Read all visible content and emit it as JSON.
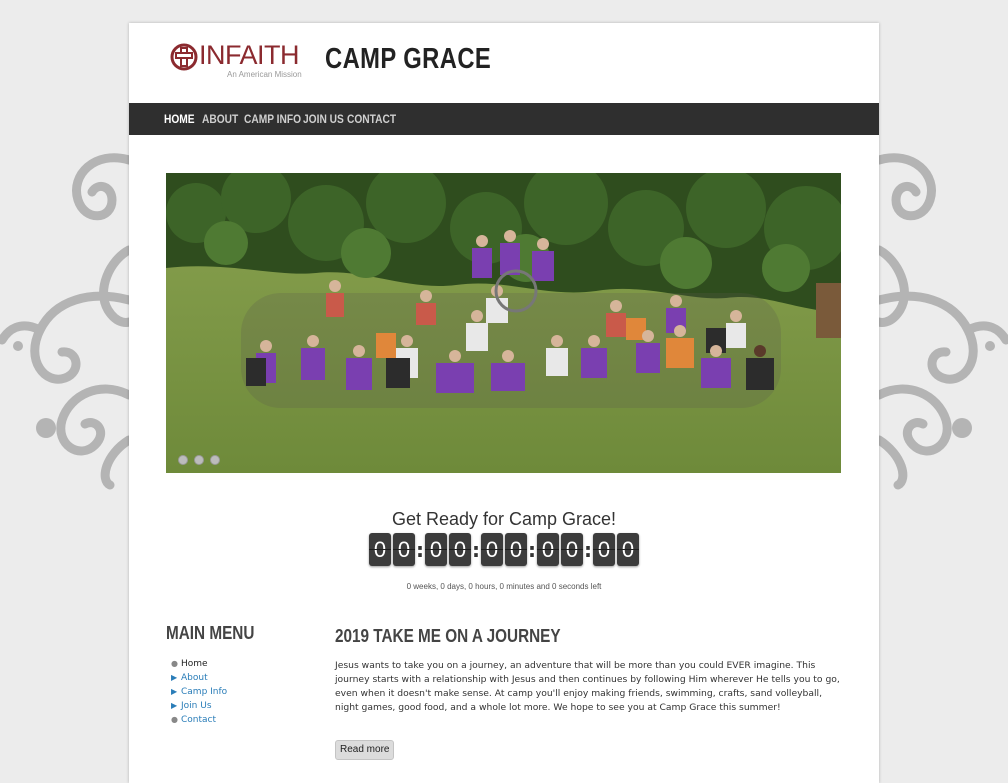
{
  "logo": {
    "wordmark": "INFAITH",
    "tagline": "An American Mission"
  },
  "site": {
    "title": "CAMP GRACE"
  },
  "nav": {
    "items": [
      {
        "label": "HOME"
      },
      {
        "label": "ABOUT"
      },
      {
        "label": "CAMP INFO"
      },
      {
        "label": "JOIN US"
      },
      {
        "label": "CONTACT"
      }
    ]
  },
  "hero": {
    "slide_count": 3,
    "active_slide": 1
  },
  "countdown": {
    "title": "Get Ready for Camp Grace!",
    "digits": [
      "0",
      "0",
      "0",
      "0",
      "0",
      "0",
      "0",
      "0",
      "0",
      "0",
      "0",
      "0"
    ],
    "text": "0 weeks, 0 days, 0 hours, 0 minutes and 0 seconds left"
  },
  "sidebar": {
    "title": "MAIN MENU",
    "items": [
      {
        "label": "Home"
      },
      {
        "label": "About"
      },
      {
        "label": "Camp Info"
      },
      {
        "label": "Join Us"
      },
      {
        "label": "Contact"
      }
    ]
  },
  "post": {
    "title": "2019 TAKE ME ON A JOURNEY",
    "body": "Jesus wants to take you on a journey, an adventure that will be more than you could EVER imagine. This journey starts with a relationship with Jesus and then continues by following Him wherever He tells you to go, even when it doesn't make sense. At camp you'll enjoy making friends, swimming, crafts, sand volleyball, night games, good food, and a whole lot more. We hope to see you at Camp Grace this summer!",
    "read_more": "Read more"
  },
  "colors": {
    "brand": "#8b2a2f",
    "nav_bg": "#2f2f2f",
    "link": "#2a7db8"
  }
}
